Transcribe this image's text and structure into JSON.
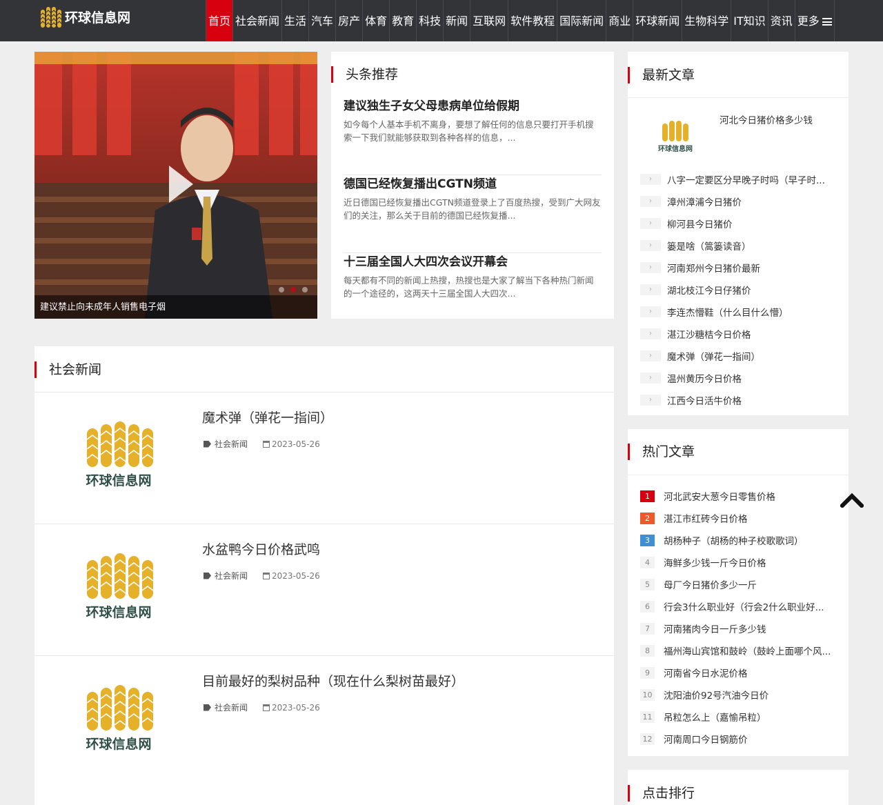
{
  "site": {
    "name": "环球信息网"
  },
  "nav": {
    "items": [
      "首页",
      "社会新闻",
      "生活",
      "汽车",
      "房产",
      "体育",
      "教育",
      "科技",
      "新闻",
      "互联网",
      "软件教程",
      "国际新闻",
      "商业",
      "环球新闻",
      "生物科学",
      "IT知识",
      "资讯"
    ],
    "more_label": "更多",
    "active": "首页"
  },
  "slider": {
    "caption": "建议禁止向未成年人销售电子烟",
    "dots": 3,
    "active_dot": 2
  },
  "headline": {
    "title": "头条推荐",
    "items": [
      {
        "title": "建议独生子女父母患病单位给假期",
        "desc": "如今每个人基本手机不离身，要想了解任何的信息只要打开手机搜索一下我们就能够获取到各种各样的信息，..."
      },
      {
        "title": "德国已经恢复播出CGTN频道",
        "desc": "近日德国已经恢复播出CGTN频道登录上了百度热搜，受到广大网友们的关注，那么关于目前的德国已经恢复播..."
      },
      {
        "title": "十三届全国人大四次会议开幕会",
        "desc": "每天都有不同的新闻上热搜，热搜也是大家了解当下各种热门新闻的一个途径的，这两天十三届全国人大四次..."
      }
    ]
  },
  "social": {
    "title": "社会新闻",
    "articles": [
      {
        "title": "魔术弹（弹花一指间）",
        "category": "社会新闻",
        "date": "2023-05-26"
      },
      {
        "title": "水盆鸭今日价格武鸣",
        "category": "社会新闻",
        "date": "2023-05-26"
      },
      {
        "title": "目前最好的梨树品种（现在什么梨树苗最好）",
        "category": "社会新闻",
        "date": "2023-05-26"
      }
    ]
  },
  "latest": {
    "title": "最新文章",
    "top_item": "河北今日猪价格多少钱",
    "chevron": "›",
    "items": [
      "八字一定要区分早晚子时吗（早子时...",
      "漳州漳浦今日猪价",
      "柳河县今日猪价",
      "篓是啥（篙篓读音）",
      "河南郑州今日猪价最新",
      "湖北枝江今日仔猪价",
      "李连杰懵鞋（什么目什么懵）",
      "湛江沙糖桔今日价格",
      "魔术弹（弹花一指间）",
      "温州黄历今日价格",
      "江西今日活牛价格"
    ]
  },
  "hot": {
    "title": "热门文章",
    "items": [
      {
        "rank": "1",
        "text": "河北武安大葱今日零售价格"
      },
      {
        "rank": "2",
        "text": "湛江市红砖今日价格"
      },
      {
        "rank": "3",
        "text": "胡杨种子（胡杨的种子校歌歌词）"
      },
      {
        "rank": "4",
        "text": "海鲜多少钱一斤今日价格"
      },
      {
        "rank": "5",
        "text": "母厂今日猪价多少一斤"
      },
      {
        "rank": "6",
        "text": "行会3什么职业好（行会2什么职业好..."
      },
      {
        "rank": "7",
        "text": "河南猪肉今日一斤多少钱"
      },
      {
        "rank": "8",
        "text": "福州海山宾馆和鼓岭（鼓岭上面哪个风..."
      },
      {
        "rank": "9",
        "text": "河南省今日水泥价格"
      },
      {
        "rank": "10",
        "text": "沈阳油价92号汽油今日价"
      },
      {
        "rank": "11",
        "text": "吊粒怎么上（嘉愉吊粒）"
      },
      {
        "rank": "12",
        "text": "河南周口今日钢筋价"
      }
    ]
  },
  "clicks": {
    "title": "点击排行"
  },
  "colors": {
    "accent": "#d7000f",
    "topbar": "#333438",
    "rank2": "#f05a2b",
    "rank3": "#3e8fd6"
  }
}
